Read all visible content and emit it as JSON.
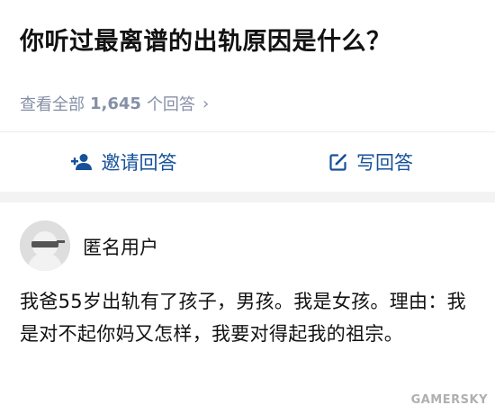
{
  "question": {
    "title": "你听过最离谱的出轨原因是什么？",
    "view_all_prefix": "查看全部",
    "answer_count": "1,645",
    "answer_suffix": "个回答",
    "chevron": "›"
  },
  "actions": {
    "invite": {
      "label": "邀请回答",
      "icon": "add-person-icon"
    },
    "write": {
      "label": "写回答",
      "icon": "edit-icon"
    }
  },
  "answer": {
    "author": "匿名用户",
    "text": "我爸55岁出轨有了孩子，男孩。我是女孩。理由：我是对不起你妈又怎样，我要对得起我的祖宗。"
  },
  "watermark": "GAMERSKY",
  "colors": {
    "accent": "#175199",
    "meta": "#8590a6",
    "separator": "#f3f3f3"
  }
}
